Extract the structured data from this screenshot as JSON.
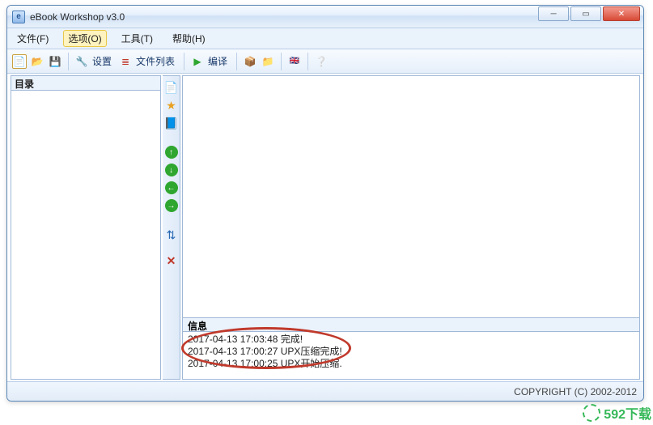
{
  "window": {
    "title": "eBook Workshop v3.0"
  },
  "menus": {
    "file": "文件(F)",
    "options": "选项(O)",
    "tools": "工具(T)",
    "help": "帮助(H)"
  },
  "toolbar": {
    "new": "新建",
    "open": "打开",
    "save": "保存",
    "settings_label": "设置",
    "filelist_label": "文件列表",
    "compile_label": "编译"
  },
  "left": {
    "header": "目录"
  },
  "info": {
    "header": "信息",
    "lines": [
      "2017-04-13 17:03:48 完成!",
      "2017-04-13 17:00:27 UPX压缩完成!",
      "2017-04-13 17:00:25 UPX开始压缩."
    ]
  },
  "status": {
    "copyright": "COPYRIGHT (C) 2002-2012"
  },
  "watermark": {
    "text": "592下载"
  }
}
